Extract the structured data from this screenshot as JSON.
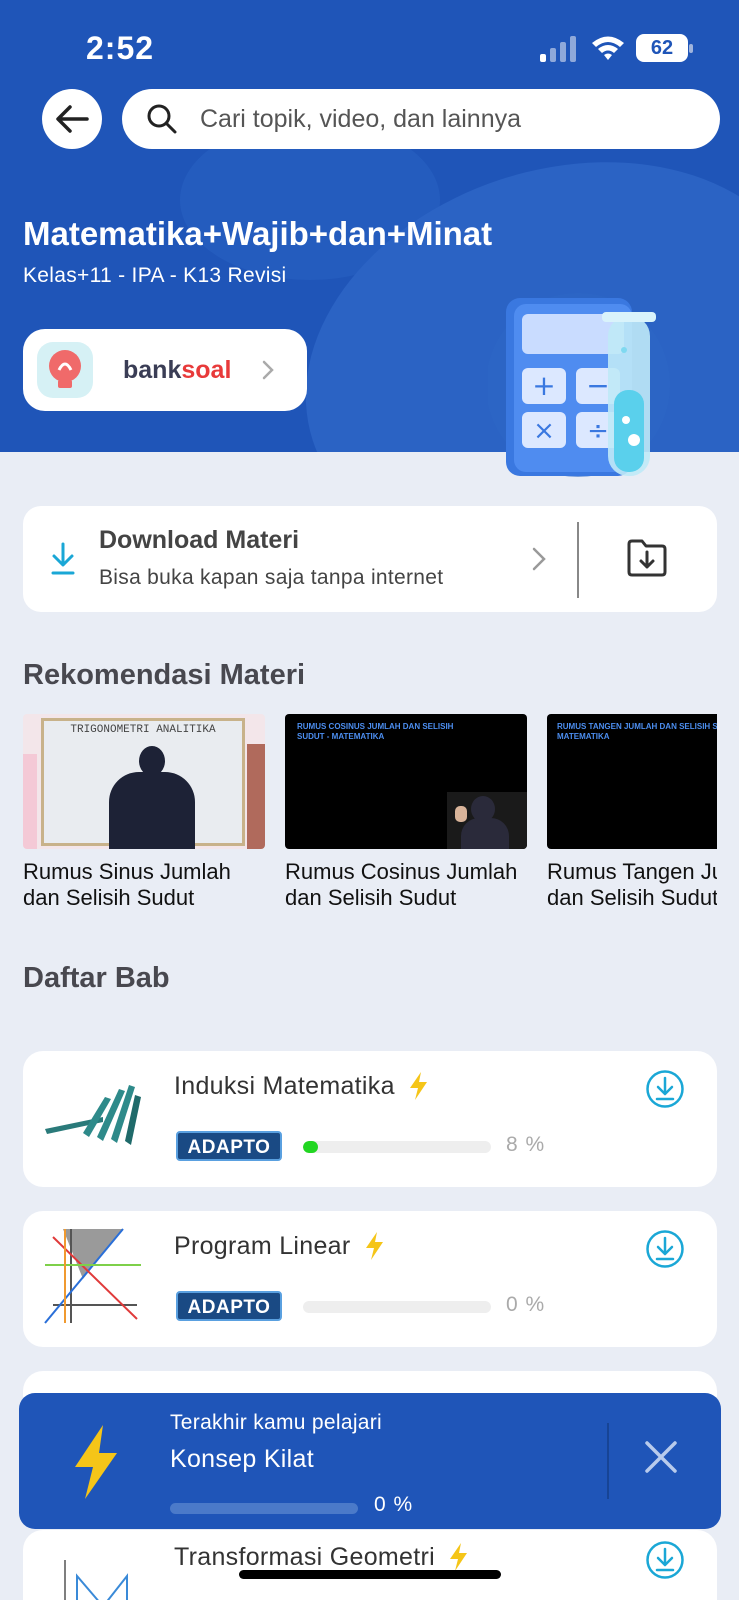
{
  "status_bar": {
    "time": "2:52",
    "battery": "62"
  },
  "search": {
    "placeholder": "Cari topik, video, dan lainnya"
  },
  "subject": {
    "title": "Matematika+Wajib+dan+Minat",
    "subtitle": "Kelas+11 - IPA - K13 Revisi"
  },
  "banksoal": {
    "bank": "bank",
    "soal": "soal"
  },
  "download_card": {
    "title": "Download Materi",
    "subtitle": "Bisa buka kapan saja tanpa internet"
  },
  "recommendations": {
    "section_title": "Rekomendasi Materi",
    "items": [
      {
        "line1": "Rumus Sinus Jumlah",
        "line2": "dan Selisih Sudut",
        "board_text": "TRIGONOMETRI ANALITIKA"
      },
      {
        "line1": "Rumus Cosinus Jumlah",
        "line2": "dan Selisih Sudut",
        "board_text": "RUMUS COSINUS JUMLAH DAN SELISIH SUDUT - MATEMATIKA"
      },
      {
        "line1": "Rumus Tangen Jumlah",
        "line2": "dan Selisih Sudut",
        "board_text": "RUMUS TANGEN JUMLAH DAN SELISIH SUDUT - MATEMATIKA"
      }
    ]
  },
  "chapters": {
    "section_title": "Daftar Bab",
    "items": [
      {
        "title": "Induksi Matematika",
        "badge": "ADAPTO",
        "progress_label": "8 %",
        "progress": 8
      },
      {
        "title": "Program Linear",
        "badge": "ADAPTO",
        "progress_label": "0 %",
        "progress": 0
      },
      {
        "title": "Transformasi Geometri"
      }
    ]
  },
  "last_learned": {
    "label": "Terakhir kamu pelajari",
    "title": "Konsep Kilat",
    "progress_label": "0 %",
    "progress": 0
  },
  "colors": {
    "primary_blue": "#1f55b8",
    "progress_green": "#22d622",
    "bolt_yellow": "#f5c518",
    "banksoal_red": "#e83a3a",
    "download_cyan": "#1aa7d6"
  }
}
